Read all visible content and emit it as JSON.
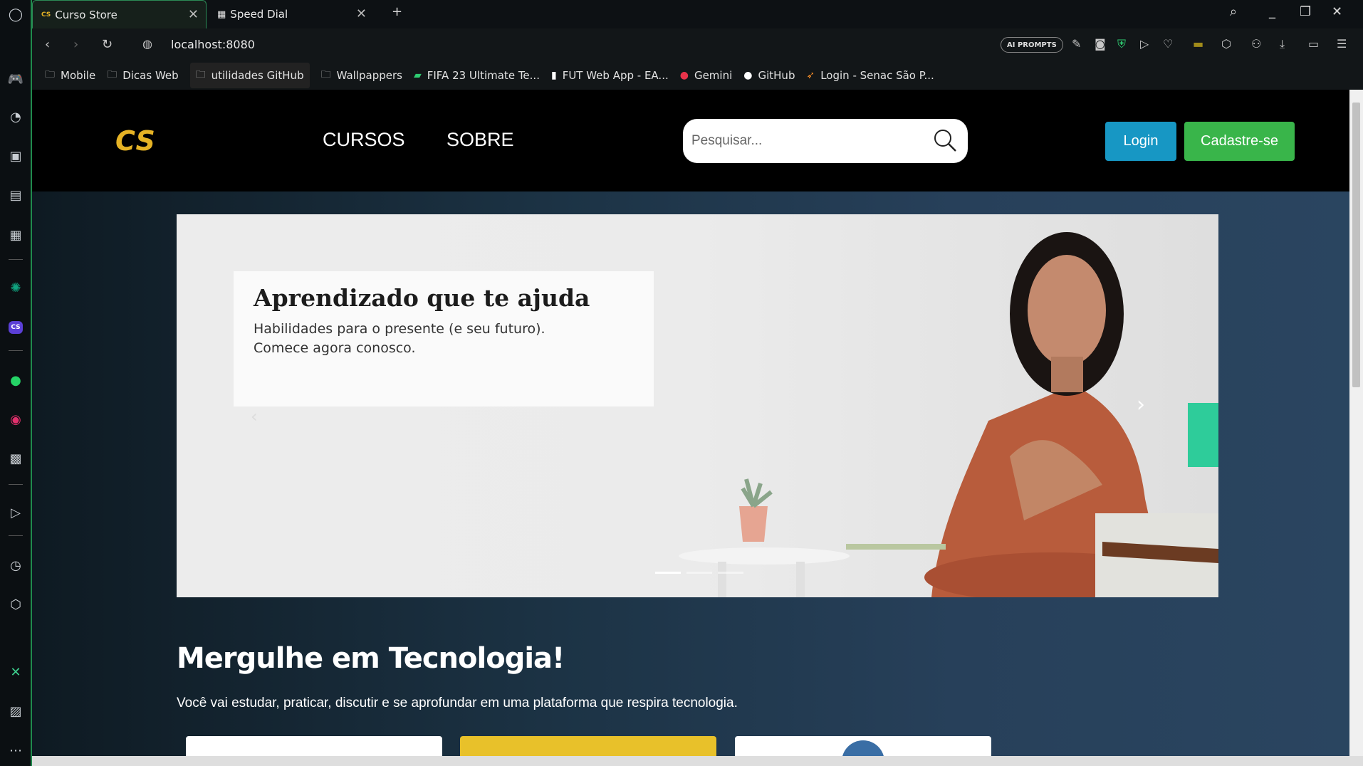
{
  "browser": {
    "tabs": [
      {
        "label": "Curso Store",
        "favicon": "CS",
        "active": true
      },
      {
        "label": "Speed Dial",
        "favicon": "grid-icon",
        "active": false
      }
    ],
    "address": "localhost:8080",
    "ai_prompts_label": "AI PROMPTS",
    "bookmarks": [
      {
        "label": "Mobile",
        "icon": "folder-icon"
      },
      {
        "label": "Dicas Web",
        "icon": "folder-icon"
      },
      {
        "label": "utilidades GitHub",
        "icon": "folder-icon"
      },
      {
        "label": "Wallpappers",
        "icon": "folder-icon"
      },
      {
        "label": "FIFA 23 Ultimate Te...",
        "icon": "fifa-icon"
      },
      {
        "label": "FUT Web App - EA...",
        "icon": "page-icon"
      },
      {
        "label": "Gemini",
        "icon": "gemini-icon"
      },
      {
        "label": "GitHub",
        "icon": "github-icon"
      },
      {
        "label": "Login - Senac São P...",
        "icon": "senac-icon"
      }
    ]
  },
  "site": {
    "logo": "CS",
    "nav": {
      "courses": "CURSOS",
      "about": "SOBRE"
    },
    "search_placeholder": "Pesquisar...",
    "login": "Login",
    "signup": "Cadastre-se",
    "hero": {
      "title": "Aprendizado que te ajuda",
      "subtitle_line1": "Habilidades para o presente (e seu futuro).",
      "subtitle_line2": "Comece agora conosco."
    },
    "section_title": "Mergulhe em Tecnologia!",
    "section_subtitle": "Você vai estudar, praticar, discutir e se aprofundar em uma plataforma que respira tecnologia."
  },
  "colors": {
    "accent_logo": "#e6b325",
    "login_btn": "#1797c4",
    "signup_btn": "#39b54a",
    "card_yellow": "#e8c12a"
  }
}
